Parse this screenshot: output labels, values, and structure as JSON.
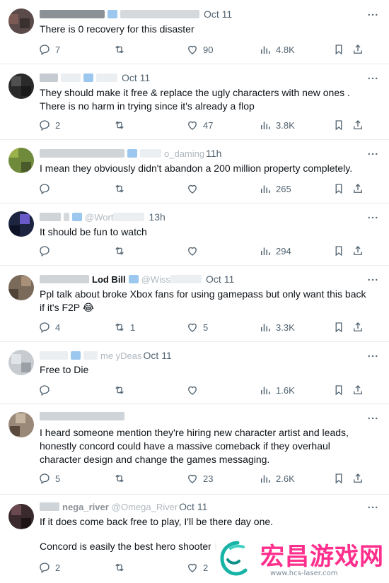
{
  "tweets": [
    {
      "time": "Oct 11",
      "text": [
        "There is 0 recovery for this disaster"
      ],
      "replies": "7",
      "retweets": "",
      "likes": "90",
      "views": "4.8K"
    },
    {
      "time": "Oct 11",
      "text": [
        "They should make it free & replace the ugly characters with new ones .",
        "There is no harm in trying since it's already a flop"
      ],
      "replies": "2",
      "retweets": "",
      "likes": "47",
      "views": "3.8K"
    },
    {
      "time": "11h",
      "text": [
        "I mean they obviously didn't abandon a 200 million property completely."
      ],
      "replies": "",
      "retweets": "",
      "likes": "",
      "views": "265"
    },
    {
      "time": "13h",
      "text": [
        "It should be fun to watch"
      ],
      "replies": "",
      "retweets": "",
      "likes": "",
      "views": "294"
    },
    {
      "time": "Oct 11",
      "text": [
        "Ppl talk about broke Xbox fans for using gamepass but only want this back",
        "if it's F2P 😂"
      ],
      "replies": "4",
      "retweets": "1",
      "likes": "5",
      "views": "3.3K"
    },
    {
      "time": "Oct 11",
      "text": [
        "Free to Die"
      ],
      "replies": "",
      "retweets": "",
      "likes": "",
      "views": "1.6K"
    },
    {
      "time": "",
      "text": [
        "I heard someone mention they're hiring new character artist and leads,",
        "honestly concord could have a massive comeback if they overhaul",
        "character design and change the games messaging."
      ],
      "replies": "5",
      "retweets": "",
      "likes": "23",
      "views": "2.6K"
    },
    {
      "time": "Oct 11",
      "text": [
        "If it does come back free to play, I'll be there day one.",
        "",
        "Concord is easily the best hero shooter I"
      ],
      "replies": "2",
      "retweets": "",
      "likes": "2",
      "views": ""
    }
  ],
  "header_fragments": {
    "t4": "@Wort",
    "t5_name": "Lod Bill",
    "t5_handle": "@Wiss",
    "t6_handle": "me  yDeas",
    "t8_name": "nega_river",
    "t8_handle": "@Omega_River",
    "t3_handle": "o_daming"
  },
  "watermark": {
    "brand": "宏昌游戏网",
    "url": "www.hcs-laser.com"
  },
  "colors": {
    "text": "#0f1419",
    "muted": "#536471",
    "divider": "#e6ecf0",
    "brand": "#ff2f8d"
  }
}
